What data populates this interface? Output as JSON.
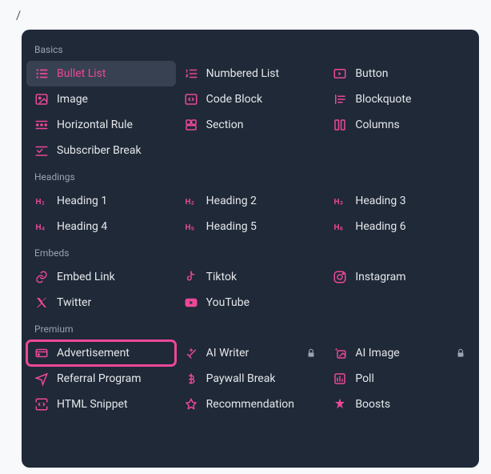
{
  "slash": "/",
  "sections": {
    "basics": {
      "title": "Basics",
      "items": [
        {
          "label": "Bullet List",
          "icon": "bullet-list-icon",
          "active": true
        },
        {
          "label": "Numbered List",
          "icon": "numbered-list-icon"
        },
        {
          "label": "Button",
          "icon": "button-icon"
        },
        {
          "label": "Image",
          "icon": "image-icon"
        },
        {
          "label": "Code Block",
          "icon": "code-block-icon"
        },
        {
          "label": "Blockquote",
          "icon": "blockquote-icon"
        },
        {
          "label": "Horizontal Rule",
          "icon": "horizontal-rule-icon"
        },
        {
          "label": "Section",
          "icon": "section-icon"
        },
        {
          "label": "Columns",
          "icon": "columns-icon"
        },
        {
          "label": "Subscriber Break",
          "icon": "subscriber-break-icon"
        }
      ]
    },
    "headings": {
      "title": "Headings",
      "items": [
        {
          "label": "Heading 1",
          "icon": "heading1-icon"
        },
        {
          "label": "Heading 2",
          "icon": "heading2-icon"
        },
        {
          "label": "Heading 3",
          "icon": "heading3-icon"
        },
        {
          "label": "Heading 4",
          "icon": "heading4-icon"
        },
        {
          "label": "Heading 5",
          "icon": "heading5-icon"
        },
        {
          "label": "Heading 6",
          "icon": "heading6-icon"
        }
      ]
    },
    "embeds": {
      "title": "Embeds",
      "items": [
        {
          "label": "Embed Link",
          "icon": "link-icon"
        },
        {
          "label": "Tiktok",
          "icon": "tiktok-icon"
        },
        {
          "label": "Instagram",
          "icon": "instagram-icon"
        },
        {
          "label": "Twitter",
          "icon": "twitter-icon"
        },
        {
          "label": "YouTube",
          "icon": "youtube-icon"
        }
      ]
    },
    "premium": {
      "title": "Premium",
      "items": [
        {
          "label": "Advertisement",
          "icon": "advertisement-icon",
          "highlighted": true
        },
        {
          "label": "AI Writer",
          "icon": "ai-writer-icon",
          "locked": true
        },
        {
          "label": "AI Image",
          "icon": "ai-image-icon",
          "locked": true
        },
        {
          "label": "Referral Program",
          "icon": "referral-icon"
        },
        {
          "label": "Paywall Break",
          "icon": "paywall-icon"
        },
        {
          "label": "Poll",
          "icon": "poll-icon"
        },
        {
          "label": "HTML Snippet",
          "icon": "html-snippet-icon"
        },
        {
          "label": "Recommendation",
          "icon": "recommendation-icon"
        },
        {
          "label": "Boosts",
          "icon": "boosts-icon"
        }
      ]
    }
  }
}
